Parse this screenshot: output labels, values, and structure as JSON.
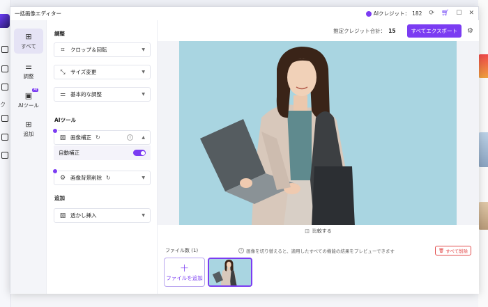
{
  "window": {
    "title": "一括画像エディター"
  },
  "titlebar": {
    "credit_label": "AIクレジット：",
    "credit_value": "182"
  },
  "background": {
    "side_text": "ク"
  },
  "rail": {
    "items": [
      {
        "label": "すべて",
        "icon": "grid-icon"
      },
      {
        "label": "調整",
        "icon": "sliders-icon"
      },
      {
        "label": "AIツール",
        "icon": "ai-icon",
        "badge": "AI"
      },
      {
        "label": "追加",
        "icon": "plus-box-icon"
      }
    ]
  },
  "panel": {
    "adjust_title": "調整",
    "crop_label": "クロップ＆回転",
    "resize_label": "サイズ変更",
    "basic_label": "基本的な調整",
    "ai_title": "AIツール",
    "enhance_label": "画像補正",
    "auto_enhance_label": "自動補正",
    "auto_enhance_on": true,
    "bg_remove_label": "画像背景削除",
    "add_title": "追加",
    "watermark_label": "透かし挿入"
  },
  "main": {
    "est_label": "推定クレジット合計：",
    "est_value": "15",
    "export_label": "すべてエクスポート",
    "compare_label": "比較する",
    "file_count_label": "ファイル数 (1)",
    "hint": "画像を切り替えると、適用したすべての機能の結果をプレビューできます",
    "delete_all_label": "すべて削除",
    "add_file_label": "ファイルを追加"
  },
  "colors": {
    "accent": "#7b3cf2",
    "photo_bg": "#a8d4e0",
    "danger": "#e24a4a"
  }
}
